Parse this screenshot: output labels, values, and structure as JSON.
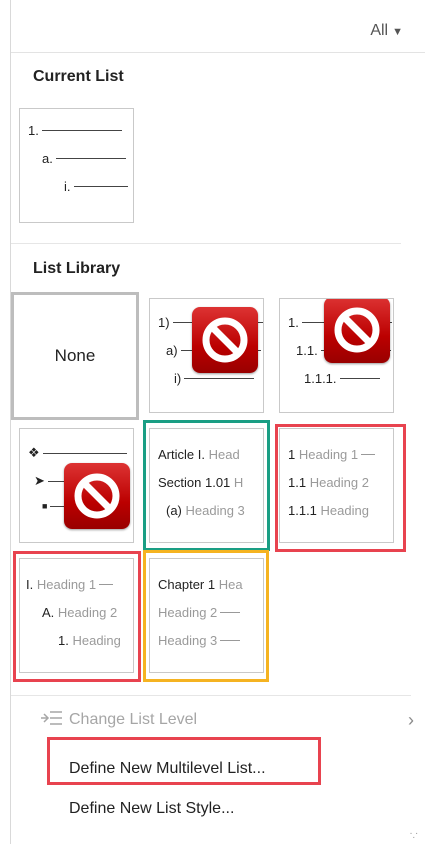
{
  "filter": {
    "label": "All"
  },
  "current_list": {
    "title": "Current List",
    "levels": [
      "1.",
      "a.",
      "i."
    ]
  },
  "list_library": {
    "title": "List Library",
    "none_label": "None",
    "tile2": [
      "1)",
      "a)",
      "i)"
    ],
    "tile3": [
      "1.",
      "1.1.",
      "1.1.1."
    ],
    "tile4_bullets": [
      "❖",
      "➤",
      "■"
    ],
    "tile5": {
      "r1a": "Article I.",
      "r1b": "Head",
      "r2a": "Section 1.01",
      "r2b": "H",
      "r3a": "(a)",
      "r3b": "Heading 3"
    },
    "tile6": {
      "r1a": "1",
      "r1b": "Heading 1",
      "r2a": "1.1",
      "r2b": "Heading 2",
      "r3a": "1.1.1",
      "r3b": "Heading"
    },
    "tile7": {
      "r1a": "I.",
      "r1b": "Heading 1",
      "r2a": "A.",
      "r2b": "Heading 2",
      "r3a": "1.",
      "r3b": "Heading"
    },
    "tile8": {
      "r1a": "Chapter 1",
      "r1b": "Hea",
      "r2b": "Heading 2",
      "r3b": "Heading 3"
    }
  },
  "menu": {
    "change_level": "Change List Level",
    "define_multilevel": "Define New Multilevel List...",
    "define_style": "Define New List Style..."
  },
  "colors": {
    "red_highlight": "#e8434f",
    "teal_highlight": "#1a9e84",
    "orange_highlight": "#f5b321",
    "block_icon": "#c00000"
  },
  "icons": {
    "blocked": "no-entry-icon",
    "list_level": "list-indent-icon",
    "submenu": "chevron-right-icon",
    "dropdown": "caret-down-icon"
  }
}
